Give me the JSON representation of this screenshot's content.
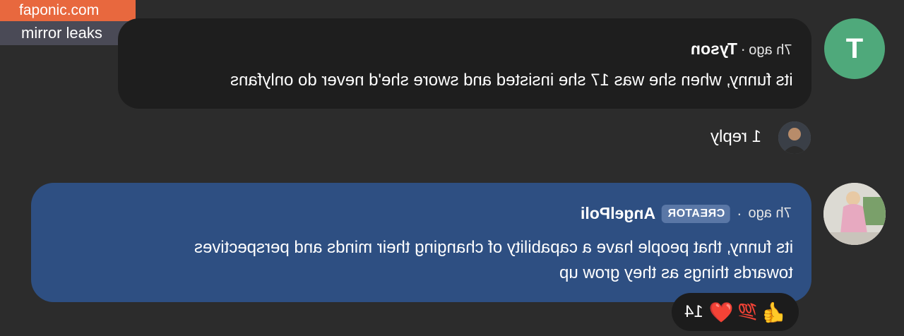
{
  "watermark": {
    "site": "faponic.com",
    "tagline": "mirror leaks"
  },
  "comments": [
    {
      "avatar_letter": "T",
      "author": "Tyson",
      "separator": "·",
      "time": "7h ago",
      "text": "its funny, when she was 17 she insisted and swore she'd never do onlyfans",
      "replies_label": "1 reply"
    },
    {
      "author": "AngelPoli",
      "badge": "CREATOR",
      "separator": "·",
      "time": "7h ago",
      "text_line1": "its funny, that people have a capability of changing their minds and perspectives",
      "text_line2": "towards things as they grow up",
      "reactions": {
        "emojis": [
          "👍",
          "💯",
          "❤️"
        ],
        "count": "14"
      }
    }
  ]
}
